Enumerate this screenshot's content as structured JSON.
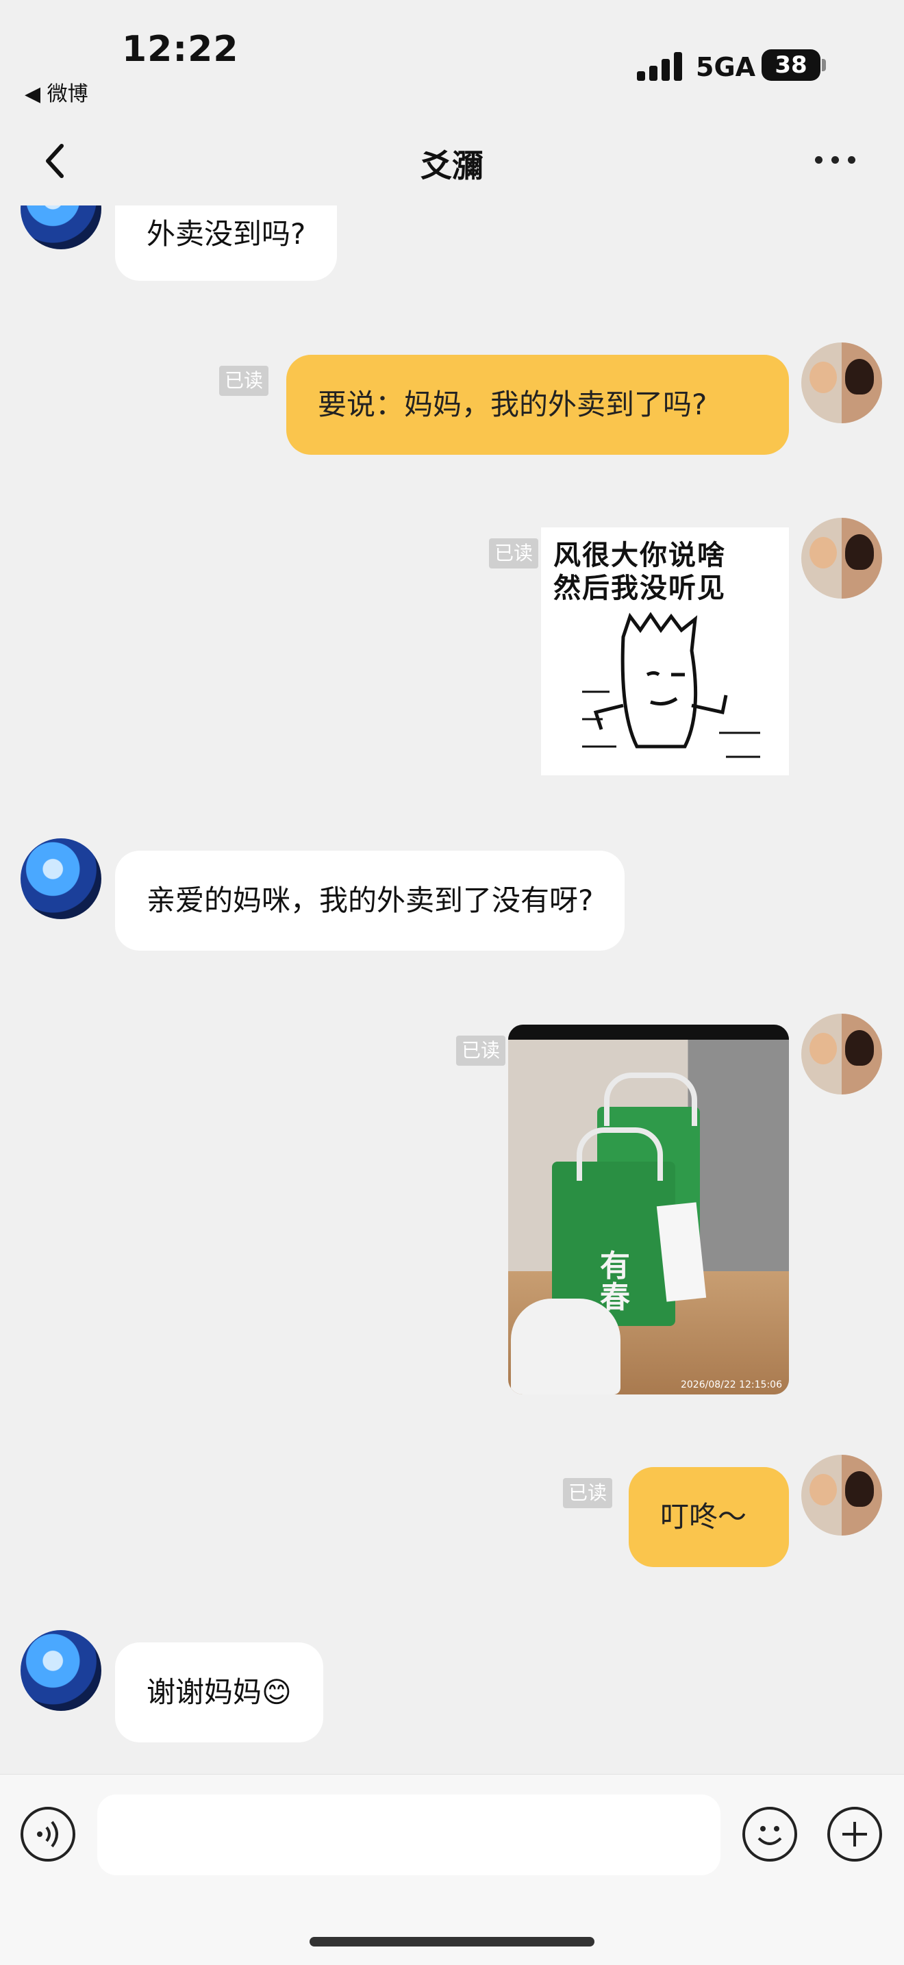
{
  "status_bar": {
    "time": "12:22",
    "back_app": "◀ 微博",
    "network": "5GA",
    "battery": "38"
  },
  "header": {
    "title": "爻瀰",
    "back_icon": "chevron-left-icon",
    "more_icon": "more-dots-icon"
  },
  "messages": [
    {
      "side": "left",
      "type": "text",
      "text": "外卖没到吗?"
    },
    {
      "side": "right",
      "type": "text",
      "text": "要说：妈妈，我的外卖到了吗?",
      "read": "已读"
    },
    {
      "side": "right",
      "type": "sticker",
      "text_lines": [
        "风很大你说啥",
        "然后我没听见"
      ],
      "read": "已读"
    },
    {
      "side": "left",
      "type": "text",
      "text": "亲爱的妈咪，我的外卖到了没有呀?"
    },
    {
      "side": "right",
      "type": "image",
      "timestamp": "2026/08/22 12:15:06",
      "bag_text": "有春",
      "read": "已读"
    },
    {
      "side": "right",
      "type": "text",
      "text": "叮咚～",
      "read": "已读"
    },
    {
      "side": "left",
      "type": "text",
      "text": "谢谢妈妈😊"
    }
  ],
  "input_bar": {
    "placeholder": "",
    "voice_icon": "voice-icon",
    "emoji_icon": "emoji-icon",
    "plus_icon": "plus-icon"
  },
  "colors": {
    "own_bubble": "#fac54d",
    "other_bubble": "#ffffff",
    "background": "#f0f0f0"
  }
}
